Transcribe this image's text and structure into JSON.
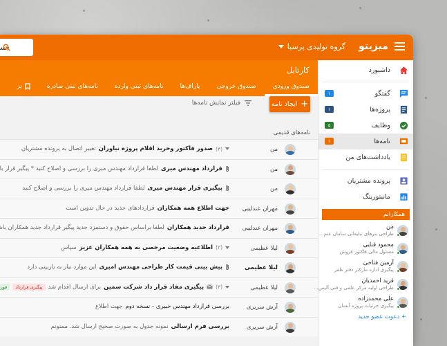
{
  "topbar": {
    "brand": "میزیتو",
    "company": "گروه تولیدی پرسیا",
    "search_value": "جس"
  },
  "colors": {
    "accent": "#ef6c00",
    "accent_light": "#f57c00",
    "background": "#f2f2f2"
  },
  "section": {
    "title": "کارتابل",
    "tabs": [
      {
        "label": "صندوق ورودی",
        "active": true
      },
      {
        "label": "صندوق خروجی",
        "active": false
      },
      {
        "label": "پاراف‌ها",
        "active": false
      },
      {
        "label": "نامه‌های ثبتی وارده",
        "active": false
      },
      {
        "label": "نامه‌های ثبتی صادره",
        "active": false
      },
      {
        "label": "بز",
        "icon": "bookmark-icon",
        "active": false
      }
    ]
  },
  "toolbar": {
    "new_letter_label": "ایجاد نامه",
    "filter_label": "فیلتر نمایش نامه‌ها"
  },
  "list": {
    "group_label": "نامه‌های قدیمی",
    "rows": [
      {
        "sender": "من",
        "sender_bold": false,
        "thread": true,
        "count": "(۳)",
        "attachment": false,
        "subject": "صدور فاکتور وخرید اقلام پروژه نیاوران",
        "snippet": "تغییر اتصال به پرونده مشتریان",
        "tags": []
      },
      {
        "sender": "من",
        "sender_bold": false,
        "thread": false,
        "count": "",
        "attachment": true,
        "subject": "قرارداد مهندس میری",
        "snippet": "لطفا قرارداد مهندس میری را بررسی و اصلاح کنید * پیگیر قرار باشید ۱. متن ق",
        "tags": []
      },
      {
        "sender": "من",
        "sender_bold": false,
        "thread": false,
        "count": "",
        "attachment": true,
        "subject": "پیگیری قرار مهندس میری",
        "snippet": "لطفا قرارداد مهندس میری را بررسی و اصلاح کنید",
        "tags": []
      },
      {
        "sender": "مهران عندلیبی",
        "sender_bold": false,
        "thread": false,
        "count": "",
        "attachment": false,
        "subject": "جهت اطلاع همه همکاران",
        "snippet": "قراردادهای جدید در حال تدوین است",
        "tags": []
      },
      {
        "sender": "مهران عندلیبی",
        "sender_bold": false,
        "thread": false,
        "count": "",
        "attachment": false,
        "subject": "قرارداد جدید همکاران",
        "snippet": "لطفا براساس حقوق و دستمزد جدید پیگیر قرارداد جدید همکاران باشید",
        "tags": []
      },
      {
        "sender": "لیلا عظیمی",
        "sender_bold": false,
        "thread": true,
        "count": "(۲)",
        "attachment": false,
        "subject": "اطلاعیه وضعیت مرخصی به همه همکاران عزیز",
        "snippet": "سپاس",
        "tags": []
      },
      {
        "sender": "لیلا عظیمی",
        "sender_bold": true,
        "thread": false,
        "count": "",
        "attachment": true,
        "subject": "پیش بینی قیمت کار طراحی مهندس امیری",
        "snippet": "این موارد نیاز به بازبینی دارد",
        "tags": []
      },
      {
        "sender": "لیلا عظیمی",
        "sender_bold": false,
        "thread": true,
        "count": "(۳)",
        "attachment": false,
        "mail_icon": true,
        "subject": "پیگیری مفاد قرار داد شرکت سمین",
        "snippet": "برای ارسال اقدام شد",
        "tags": [
          {
            "label": "پیگیری قرارداد",
            "style": "red"
          },
          {
            "label": "فوری",
            "style": "green"
          },
          {
            "label": "پکشنبه",
            "style": "blue"
          }
        ]
      },
      {
        "sender": "آرش سریری",
        "sender_bold": false,
        "thread": false,
        "count": "",
        "attachment": false,
        "subject": "بررسی قرارداد مهندس خبیری - نسخه دوم",
        "snippet": "جهت اطلاع",
        "subject_normal": true,
        "tags": []
      },
      {
        "sender": "آرش سریری",
        "sender_bold": false,
        "thread": false,
        "count": "",
        "attachment": false,
        "subject": "بررسی فرم ارسالی",
        "snippet": "نمونه جدول به صورت صحیح ارسال شد. ممنونم",
        "tags": []
      }
    ]
  },
  "sidebar": {
    "items": [
      {
        "label": "داشبورد",
        "icon": "home-icon",
        "badge": "",
        "badge_color": ""
      },
      {
        "label": "گفتگو",
        "icon": "chat-icon",
        "badge": "۱",
        "badge_color": "#1e88e5"
      },
      {
        "label": "پروژه‌ها",
        "icon": "projects-icon",
        "badge": "۱",
        "badge_color": "#2c5282"
      },
      {
        "label": "وظایف",
        "icon": "check-circle-icon",
        "badge": "۵",
        "badge_color": "#2e7d32"
      },
      {
        "label": "نامه‌ها",
        "icon": "letters-icon",
        "badge": "۱",
        "badge_color": "#ef6c00",
        "active": true
      },
      {
        "label": "یادداشت‌های من",
        "icon": "notes-icon",
        "badge": "",
        "badge_color": ""
      },
      {
        "label": "پرونده مشتریان",
        "icon": "customer-file-icon",
        "badge": "",
        "badge_color": ""
      },
      {
        "label": "مانیتورینگ",
        "icon": "monitoring-icon",
        "badge": "",
        "badge_color": ""
      }
    ],
    "colleagues_title": "همکارانم",
    "colleagues": [
      {
        "name": "من",
        "sub": "طراحی بنرهای تبلیغاتی سامان عنم..."
      },
      {
        "name": "محمود قنایی",
        "sub": "مسئول مالی فاکتور فروش"
      },
      {
        "name": "آرمین فتاحی",
        "sub": "پیگیری اداره مارکتر دفتر ظفر"
      },
      {
        "name": "فرید احمدیان",
        "sub": "طراحی اولیه مرکز علمی و فنی آلیس..."
      },
      {
        "name": "علی محمدزاده",
        "sub": "پیگیری جزئیات پروژه آبسان"
      }
    ],
    "invite_label": "+ دعوت عضو جدید"
  }
}
